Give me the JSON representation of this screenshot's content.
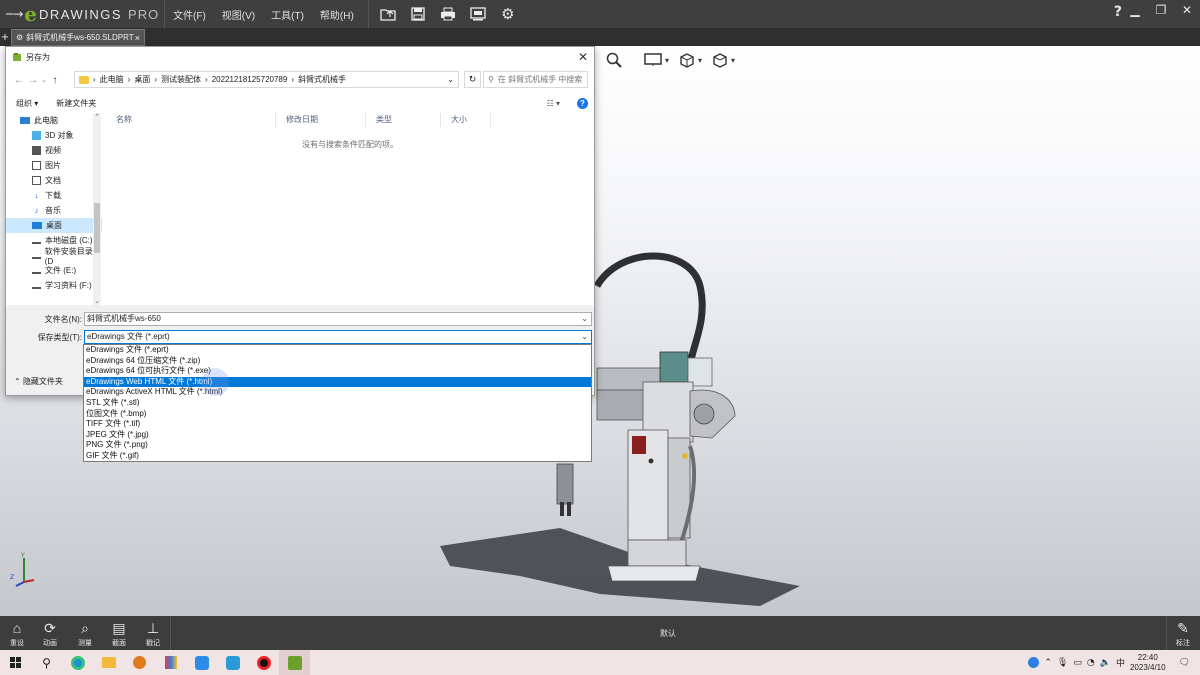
{
  "app": {
    "brand": "DRAWINGS",
    "brand_suffix": "PRO",
    "menu": [
      "文件(F)",
      "视图(V)",
      "工具(T)",
      "帮助(H)"
    ],
    "toolbar_icons": [
      "open-icon",
      "save-icon",
      "print-icon",
      "screen-icon",
      "settings-icon"
    ],
    "help": "?"
  },
  "doc_tab": {
    "label": "斜臂式机械手ws-650.SLDPRT",
    "close": "×"
  },
  "viewport_tools": [
    "zoom-icon",
    "display-icon",
    "view-orientation-icon",
    "box-icon"
  ],
  "dialog": {
    "title": "另存为",
    "breadcrumbs": [
      "此电脑",
      "桌面",
      "测试装配体",
      "20221218125720789",
      "斜臂式机械手"
    ],
    "search_placeholder": "在 斜臂式机械手 中搜索",
    "organize": "组织 ▾",
    "new_folder": "新建文件夹",
    "nav_items": [
      {
        "label": "此电脑",
        "icon": "computer-icon"
      },
      {
        "label": "3D 对象",
        "icon": "cube-icon"
      },
      {
        "label": "视频",
        "icon": "video-icon"
      },
      {
        "label": "图片",
        "icon": "picture-icon"
      },
      {
        "label": "文档",
        "icon": "document-icon"
      },
      {
        "label": "下载",
        "icon": "download-icon"
      },
      {
        "label": "音乐",
        "icon": "music-icon"
      },
      {
        "label": "桌面",
        "icon": "desktop-icon"
      },
      {
        "label": "本地磁盘 (C:)",
        "icon": "drive-icon"
      },
      {
        "label": "软件安装目录 (D",
        "icon": "drive-icon"
      },
      {
        "label": "文件 (E:)",
        "icon": "drive-icon"
      },
      {
        "label": "学习资料 (F:)",
        "icon": "drive-icon"
      }
    ],
    "columns": [
      "名称",
      "修改日期",
      "类型",
      "大小"
    ],
    "empty_message": "没有与搜索条件匹配的项。",
    "filename_label": "文件名(N):",
    "filename_value": "斜臂式机械手ws-650",
    "filetype_label": "保存类型(T):",
    "filetype_value": "eDrawings 文件 (*.eprt)",
    "hide_folders": "隐藏文件夹",
    "filetype_options": [
      "eDrawings 文件 (*.eprt)",
      "eDrawings 64 位压缩文件 (*.zip)",
      "eDrawings 64 位可执行文件 (*.exe)",
      "eDrawings Web HTML 文件 (*.html)",
      "eDrawings ActiveX HTML 文件 (*.html)",
      "STL 文件 (*.stl)",
      "位图文件 (*.bmp)",
      "TIFF 文件 (*.tif)",
      "JPEG 文件 (*.jpg)",
      "PNG 文件 (*.png)",
      "GIF 文件 (*.gif)"
    ],
    "highlighted_index": 3
  },
  "bottom_tools": [
    {
      "label": "重设",
      "icon": "home-icon"
    },
    {
      "label": "动画",
      "icon": "animate-icon"
    },
    {
      "label": "测量",
      "icon": "measure-icon"
    },
    {
      "label": "截面",
      "icon": "section-icon"
    },
    {
      "label": "戳记",
      "icon": "stamp-icon"
    }
  ],
  "bottom_center": "默认",
  "markup_tool": "标注",
  "taskbar": {
    "apps": [
      "windows-icon",
      "search-icon",
      "edge-icon",
      "explorer-icon",
      "search-app-icon",
      "app-icon",
      "app-icon-2",
      "app-icon-3",
      "record-icon",
      "edrawings-icon"
    ],
    "ime": "中",
    "time": "22:40",
    "date": "2023/4/10"
  }
}
